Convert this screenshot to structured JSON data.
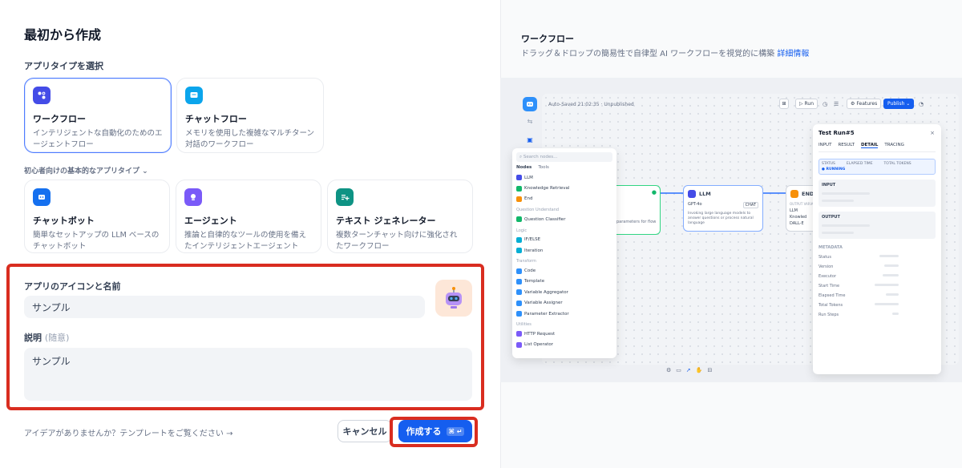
{
  "left": {
    "title": "最初から作成",
    "app_type_label": "アプリタイプを選択",
    "types": [
      {
        "name": "ワークフロー",
        "desc": "インテリジェントな自動化のためのエージェントフロー",
        "color": "#444ce7"
      },
      {
        "name": "チャットフロー",
        "desc": "メモリを使用した複雑なマルチターン対話のワークフロー",
        "color": "#0ba5ec"
      }
    ],
    "basic_label": "初心者向けの基本的なアプリタイプ",
    "basic_types": [
      {
        "name": "チャットボット",
        "desc": "簡単なセットアップの LLM ベースのチャットボット",
        "color": "#1570ef"
      },
      {
        "name": "エージェント",
        "desc": "推論と自律的なツールの使用を備えたインテリジェントエージェント",
        "color": "#7a5af8"
      },
      {
        "name": "テキスト ジェネレーター",
        "desc": "複数ターンチャット向けに強化されたワークフロー",
        "color": "#0e9384"
      }
    ],
    "name_label": "アプリのアイコンと名前",
    "name_value": "サンプル",
    "desc_label": "説明",
    "desc_optional": "(随意)",
    "desc_value": "サンプル",
    "idea_text": "アイデアがありませんか？テンプレートをご覧ください →",
    "cancel_label": "キャンセル",
    "create_label": "作成する",
    "create_kbd": "⌘ ↵"
  },
  "right": {
    "title": "ワークフロー",
    "desc": "ドラッグ＆ドロップの簡易性で自律型 AI ワークフローを視覚的に構築",
    "link": "詳細情報",
    "preview": {
      "autosaved": "Auto-Saved 21:02:35 · Unpublished",
      "run": "▷ Run",
      "features": "Features",
      "publish": "Publish ⌄",
      "search_placeholder": "Search nodes...",
      "tab_nodes": "Nodes",
      "tab_tools": "Tools",
      "items_a": [
        "LLM",
        "Knowledge Retrieval",
        "End"
      ],
      "grp_qu": "Question Understand",
      "items_b": [
        "Question Classifier"
      ],
      "grp_logic": "Logic",
      "items_c": [
        "IF/ELSE",
        "Iteration"
      ],
      "grp_transform": "Transform",
      "items_d": [
        "Code",
        "Template",
        "Variable Aggregator",
        "Variable Assigner",
        "Parameter Extractor"
      ],
      "grp_utilities": "Utilities",
      "items_e": [
        "HTTP Request",
        "List Operator"
      ],
      "llm_node": "LLM",
      "llm_model": "GPT-4o",
      "llm_chat": "CHAT",
      "llm_desc": "Invoking large language models to answer questions or process natural language",
      "start_desc": "parameters for flow",
      "end_node": "END",
      "end_output": "OUTPUT VARIABLE",
      "end_items": [
        "LLM",
        "Knowled",
        "DALL-E"
      ],
      "test_run": "Test Run#5",
      "run_tabs": [
        "INPUT",
        "RESULT",
        "DETAIL",
        "TRACING"
      ],
      "status_label": "STATUS",
      "status_value": "● RUNNING",
      "elapsed_label": "ELAPSED TIME",
      "tokens_label": "TOTAL TOKENS",
      "input_label": "INPUT",
      "output_label": "OUTPUT",
      "metadata_label": "METADATA",
      "meta_rows": [
        "Status",
        "Version",
        "Executor",
        "Start Time",
        "Elapsed Time",
        "Total Tokens",
        "Run Steps"
      ]
    }
  }
}
